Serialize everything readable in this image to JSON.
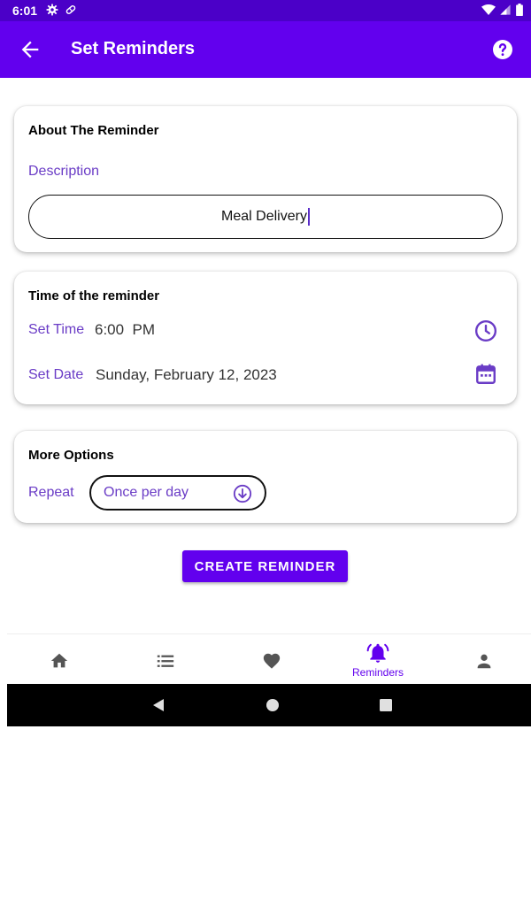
{
  "status_bar": {
    "time": "6:01"
  },
  "app_bar": {
    "title": "Set Reminders"
  },
  "about_card": {
    "title": "About The Reminder",
    "description_label": "Description",
    "description_value": "Meal Delivery"
  },
  "time_card": {
    "title": "Time of the reminder",
    "set_time_label": "Set Time",
    "time_value": "6:00  PM",
    "set_date_label": "Set Date",
    "date_value": "Sunday, February 12, 2023"
  },
  "options_card": {
    "title": "More Options",
    "repeat_label": "Repeat",
    "repeat_value": "Once per day"
  },
  "create_button": {
    "label": "CREATE REMINDER"
  },
  "bottom_nav": {
    "items": [
      {
        "icon": "home-icon",
        "label": ""
      },
      {
        "icon": "list-icon",
        "label": ""
      },
      {
        "icon": "heart-icon",
        "label": ""
      },
      {
        "icon": "bell-ring-icon",
        "label": "Reminders"
      },
      {
        "icon": "person-icon",
        "label": ""
      }
    ],
    "active_index": 3
  },
  "colors": {
    "primary": "#6200ee",
    "status_bar": "#4b00c8",
    "accent_text": "#6a3cc6"
  }
}
